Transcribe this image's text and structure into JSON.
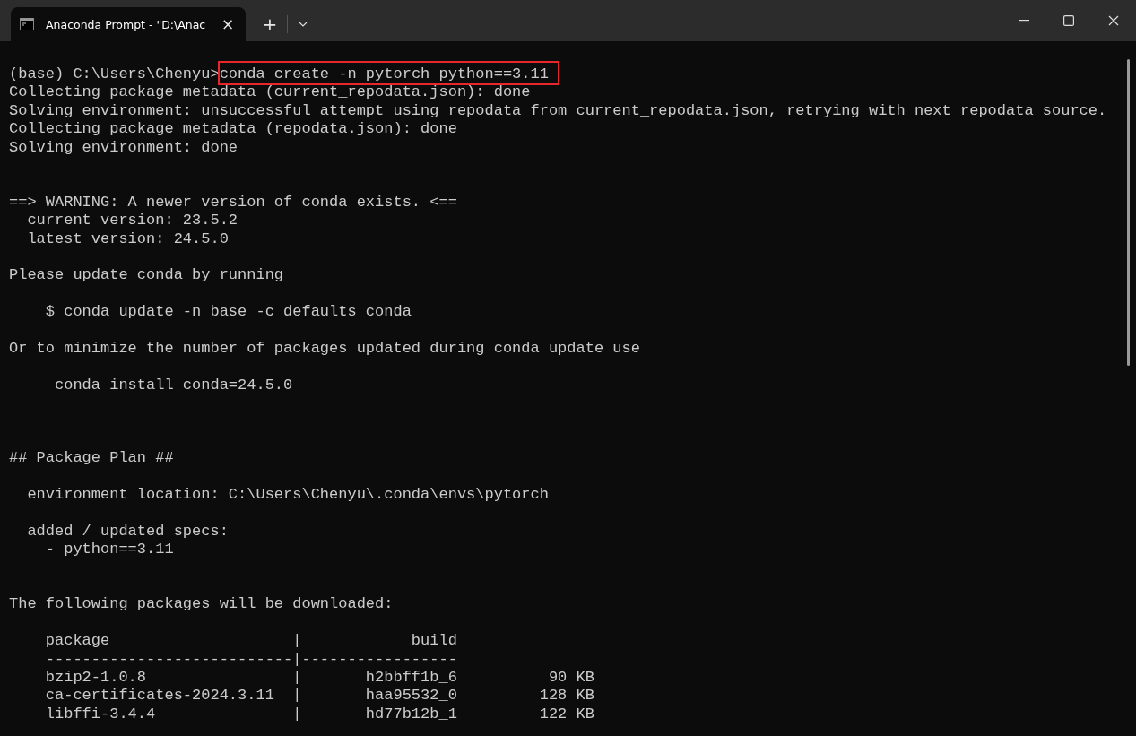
{
  "window": {
    "tab": {
      "title": "Anaconda Prompt - \"D:\\Anac",
      "selected": true,
      "close": "×"
    },
    "new_tab": "+"
  },
  "terminal": {
    "lines": [
      {
        "kind": "command",
        "prompt": "(base) C:\\Users\\Chenyu>",
        "command": "conda create -n pytorch python==3.11",
        "highlighted": true
      },
      {
        "kind": "text",
        "text": "Collecting package metadata (current_repodata.json): done"
      },
      {
        "kind": "text",
        "text": "Solving environment: unsuccessful attempt using repodata from current_repodata.json, retrying with next repodata source."
      },
      {
        "kind": "text",
        "text": "Collecting package metadata (repodata.json): done"
      },
      {
        "kind": "text",
        "text": "Solving environment: done"
      },
      {
        "kind": "blank"
      },
      {
        "kind": "blank"
      },
      {
        "kind": "text",
        "text": "==> WARNING: A newer version of conda exists. <=="
      },
      {
        "kind": "text",
        "text": "  current version: 23.5.2"
      },
      {
        "kind": "text",
        "text": "  latest version: 24.5.0"
      },
      {
        "kind": "blank"
      },
      {
        "kind": "text",
        "text": "Please update conda by running"
      },
      {
        "kind": "blank"
      },
      {
        "kind": "text",
        "text": "    $ conda update -n base -c defaults conda"
      },
      {
        "kind": "blank"
      },
      {
        "kind": "text",
        "text": "Or to minimize the number of packages updated during conda update use"
      },
      {
        "kind": "blank"
      },
      {
        "kind": "text",
        "text": "     conda install conda=24.5.0"
      },
      {
        "kind": "blank"
      },
      {
        "kind": "blank"
      },
      {
        "kind": "blank"
      },
      {
        "kind": "text",
        "text": "## Package Plan ##"
      },
      {
        "kind": "blank"
      },
      {
        "kind": "text",
        "text": "  environment location: C:\\Users\\Chenyu\\.conda\\envs\\pytorch"
      },
      {
        "kind": "blank"
      },
      {
        "kind": "text",
        "text": "  added / updated specs:"
      },
      {
        "kind": "text",
        "text": "    - python==3.11"
      },
      {
        "kind": "blank"
      },
      {
        "kind": "blank"
      },
      {
        "kind": "text",
        "text": "The following packages will be downloaded:"
      },
      {
        "kind": "blank"
      },
      {
        "kind": "text",
        "text": "    package                    |            build"
      },
      {
        "kind": "text",
        "text": "    ---------------------------|-----------------"
      },
      {
        "kind": "text",
        "text": "    bzip2-1.0.8                |       h2bbff1b_6          90 KB"
      },
      {
        "kind": "text",
        "text": "    ca-certificates-2024.3.11  |       haa95532_0         128 KB"
      },
      {
        "kind": "text",
        "text": "    libffi-3.4.4               |       hd77b12b_1         122 KB"
      }
    ]
  }
}
